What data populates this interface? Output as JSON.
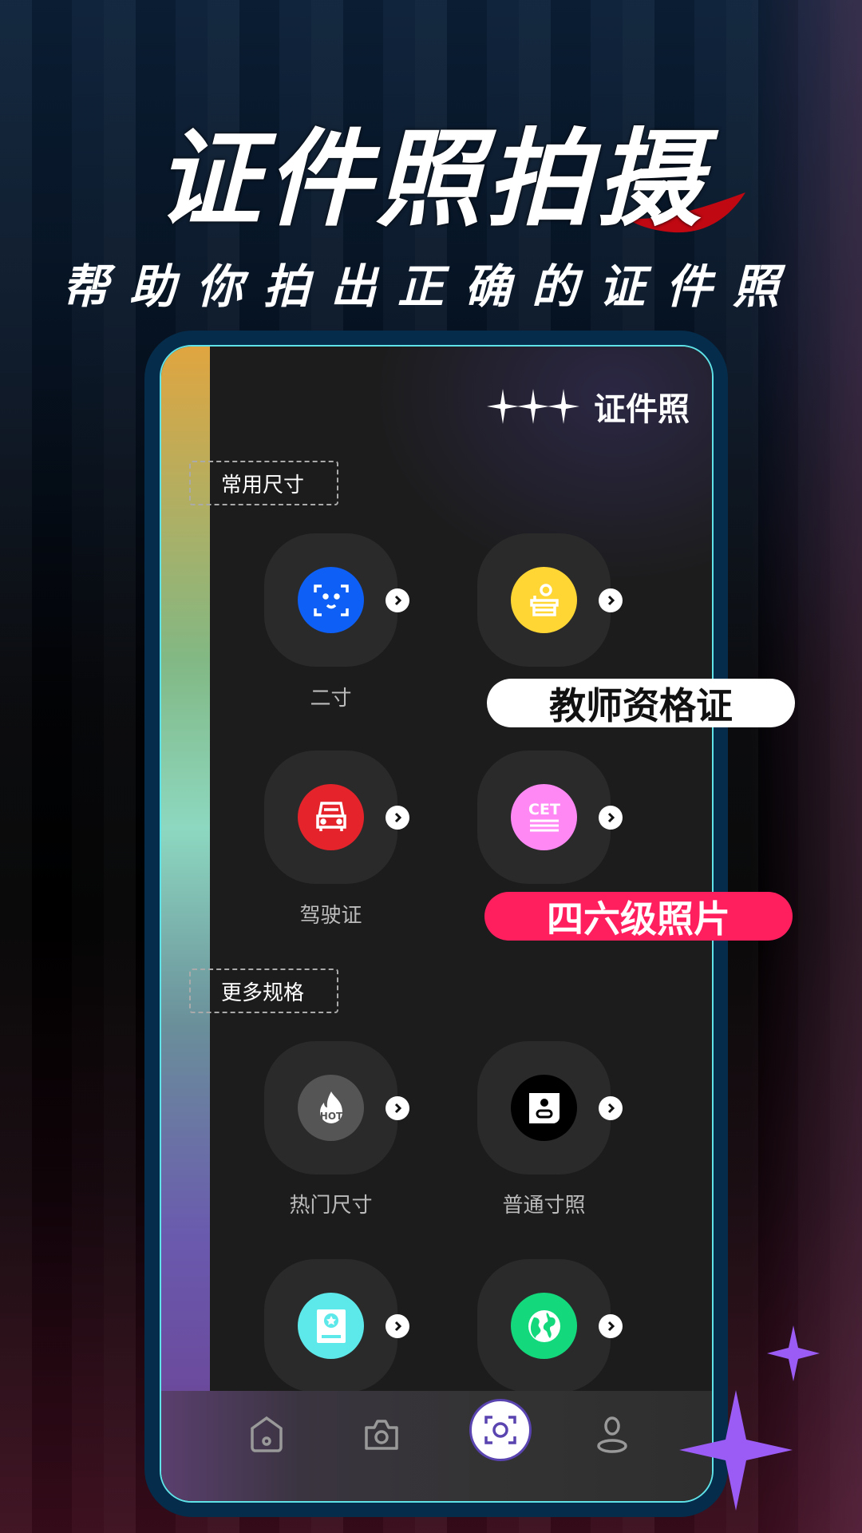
{
  "promo": {
    "title": "证件照拍摄",
    "subtitle": "帮助你拍出正确的证件照"
  },
  "app": {
    "header": {
      "title": "证件照",
      "icon": "sparkles-icon"
    },
    "sections": [
      {
        "label": "常用尺寸",
        "items": [
          {
            "label": "二寸",
            "icon": "face-scan-icon",
            "color": "#0d5ff5"
          },
          {
            "label": "教师资格证",
            "icon": "teacher-podium-icon",
            "color": "#ffd633"
          },
          {
            "label": "驾驶证",
            "icon": "car-icon",
            "color": "#e5232b"
          },
          {
            "label": "四六级照片",
            "icon": "cet-icon",
            "color": "#ff88f5"
          }
        ]
      },
      {
        "label": "更多规格",
        "items": [
          {
            "label": "热门尺寸",
            "icon": "hot-fire-icon",
            "color": "#555555"
          },
          {
            "label": "普通寸照",
            "icon": "id-photo-icon",
            "color": "#000000"
          },
          {
            "label": "",
            "icon": "passport-icon",
            "color": "#5de8ea"
          },
          {
            "label": "",
            "icon": "globe-icon",
            "color": "#14d87c"
          }
        ]
      }
    ],
    "callouts": [
      {
        "text": "教师资格证",
        "bg": "#ffffff"
      },
      {
        "text": "四六级照片",
        "bg": "#ff1f5f"
      }
    ],
    "nav": [
      {
        "icon": "home-icon"
      },
      {
        "icon": "camera-icon"
      },
      {
        "icon": "scan-capture-icon",
        "active": true
      },
      {
        "icon": "user-icon"
      }
    ],
    "accent": "#9b5cf6"
  }
}
